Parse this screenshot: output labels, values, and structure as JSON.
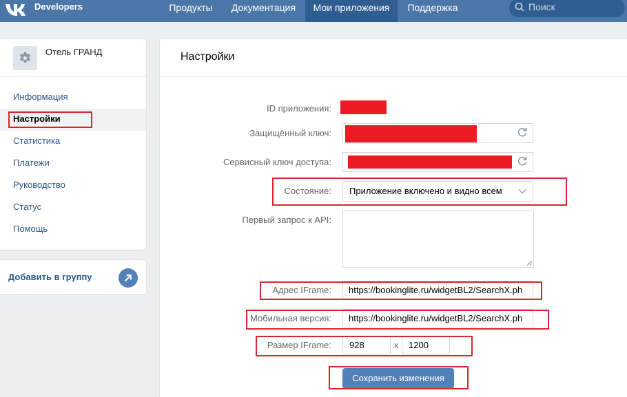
{
  "header": {
    "brand": "Developers",
    "nav": [
      {
        "label": "Продукты"
      },
      {
        "label": "Документация"
      },
      {
        "label": "Мои приложения"
      },
      {
        "label": "Поддержка"
      }
    ],
    "search_placeholder": "Поиск"
  },
  "sidebar": {
    "app_name": "Отель ГРАНД",
    "items": [
      {
        "label": "Информация"
      },
      {
        "label": "Настройки"
      },
      {
        "label": "Статистика"
      },
      {
        "label": "Платежи"
      },
      {
        "label": "Руководство"
      },
      {
        "label": "Статус"
      },
      {
        "label": "Помощь"
      }
    ],
    "add_to_group": "Добавить в группу"
  },
  "settings": {
    "title": "Настройки",
    "app_id_label": "ID приложения:",
    "secret_key_label": "Защищённый ключ:",
    "service_key_label": "Сервисный ключ доступа:",
    "state_label": "Состояние:",
    "state_value": "Приложение включено и видно всем",
    "first_request_label": "Первый запрос к API:",
    "first_request_value": "",
    "iframe_url_label": "Адрес IFrame:",
    "iframe_url_value": "https://bookinglite.ru/widgetBL2/SearchX.ph",
    "mobile_label": "Мобильная версия:",
    "mobile_value": "https://bookinglite.ru/widgetBL2/SearchX.ph",
    "iframe_size_label": "Размер IFrame:",
    "iframe_width": "928",
    "size_separator": "x",
    "iframe_height": "1200",
    "save_button": "Сохранить изменения"
  },
  "colors": {
    "header_bg": "#4a76a8",
    "accent": "#5181b8",
    "highlight": "#d9262c",
    "redaction": "#ed1c24"
  }
}
